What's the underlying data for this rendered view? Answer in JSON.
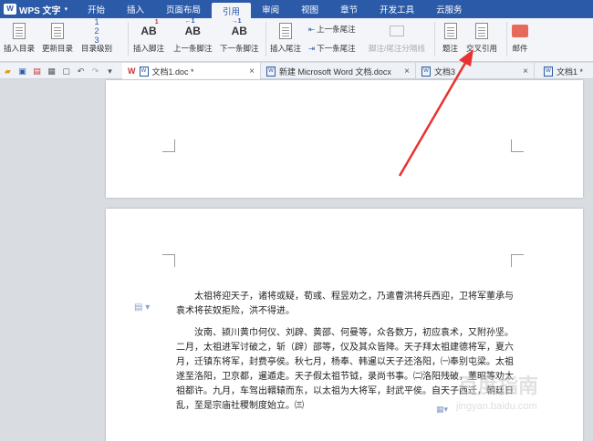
{
  "app": {
    "name": "WPS 文字",
    "logo": "W"
  },
  "menu": [
    "开始",
    "插入",
    "页面布局",
    "引用",
    "审阅",
    "视图",
    "章节",
    "开发工具",
    "云服务"
  ],
  "ribbon": {
    "insert_toc": "插入目录",
    "update_toc": "更新目录",
    "toc_level": "目录级别",
    "insert_footnote": "插入脚注",
    "prev_footnote": "上一条脚注",
    "next_footnote": "下一条脚注",
    "insert_endnote": "插入尾注",
    "prev_endnote": "上一条尾注",
    "next_endnote": "下一条尾注",
    "separator": "脚注/尾注分隔线",
    "caption": "题注",
    "cross_ref": "交叉引用",
    "mail": "邮件"
  },
  "tabs": [
    {
      "label": "文档1.doc *"
    },
    {
      "label": "新建 Microsoft Word 文档.docx"
    },
    {
      "label": "文档3"
    },
    {
      "label": "文档1 *"
    }
  ],
  "document": {
    "para1": "太祖将迎天子，诸将或疑，荀彧、程昱劝之，乃遣曹洪将兵西迎，卫将军董承与袁术将苌奴拒险，洪不得进。",
    "para2": "汝南、颍川黄巾何仪、刘辟、黄邵、何曼等，众各数万，初应袁术，又附孙坚。二月，太祖进军讨破之，斩（辟）邵等，仪及其众皆降。天子拜太祖建德将军，夏六月，迁镇东将军，封费亭侯。秋七月，杨奉、韩暹以天子还洛阳，㈠奉别屯梁。太祖遂至洛阳，卫京都，暹遁走。天子假太祖节钺，录尚书事。㈡洛阳残破，董昭等劝太祖都许。九月，车驾出轘辕而东，以太祖为大将军，封武平侯。自天子西迁，朝廷日乱，至是宗庙社稷制度始立。㈢"
  },
  "watermark": {
    "main": "百度指南",
    "sub": "jingyan.baidu.com"
  },
  "colors": {
    "brand": "#2b5aa8",
    "arrow": "#e8322f"
  }
}
